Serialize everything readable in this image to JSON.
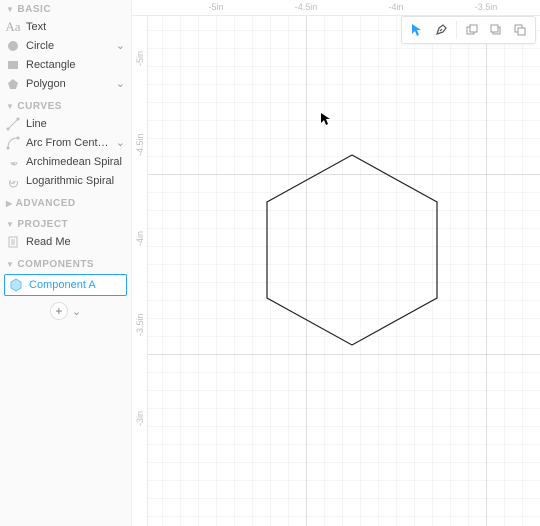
{
  "sidebar": {
    "basic": {
      "title": "BASIC",
      "text": "Text",
      "circle": "Circle",
      "rectangle": "Rectangle",
      "polygon": "Polygon"
    },
    "curves": {
      "title": "CURVES",
      "line": "Line",
      "arc": "Arc From Cente…",
      "arch": "Archimedean Spiral",
      "log": "Logarithmic Spiral"
    },
    "advanced": {
      "title": "ADVANCED"
    },
    "project": {
      "title": "PROJECT",
      "readme": "Read Me"
    },
    "components": {
      "title": "COMPONENTS",
      "a": "Component A"
    }
  },
  "ruler": {
    "top": [
      "-5in",
      "-4.5in",
      "-4in",
      "-3.5in"
    ],
    "left": [
      "-5in",
      "-4.5in",
      "-4in",
      "-3.5in",
      "-3in"
    ]
  },
  "toolbar": {
    "select": "select-tool",
    "pen": "pen-tool"
  }
}
